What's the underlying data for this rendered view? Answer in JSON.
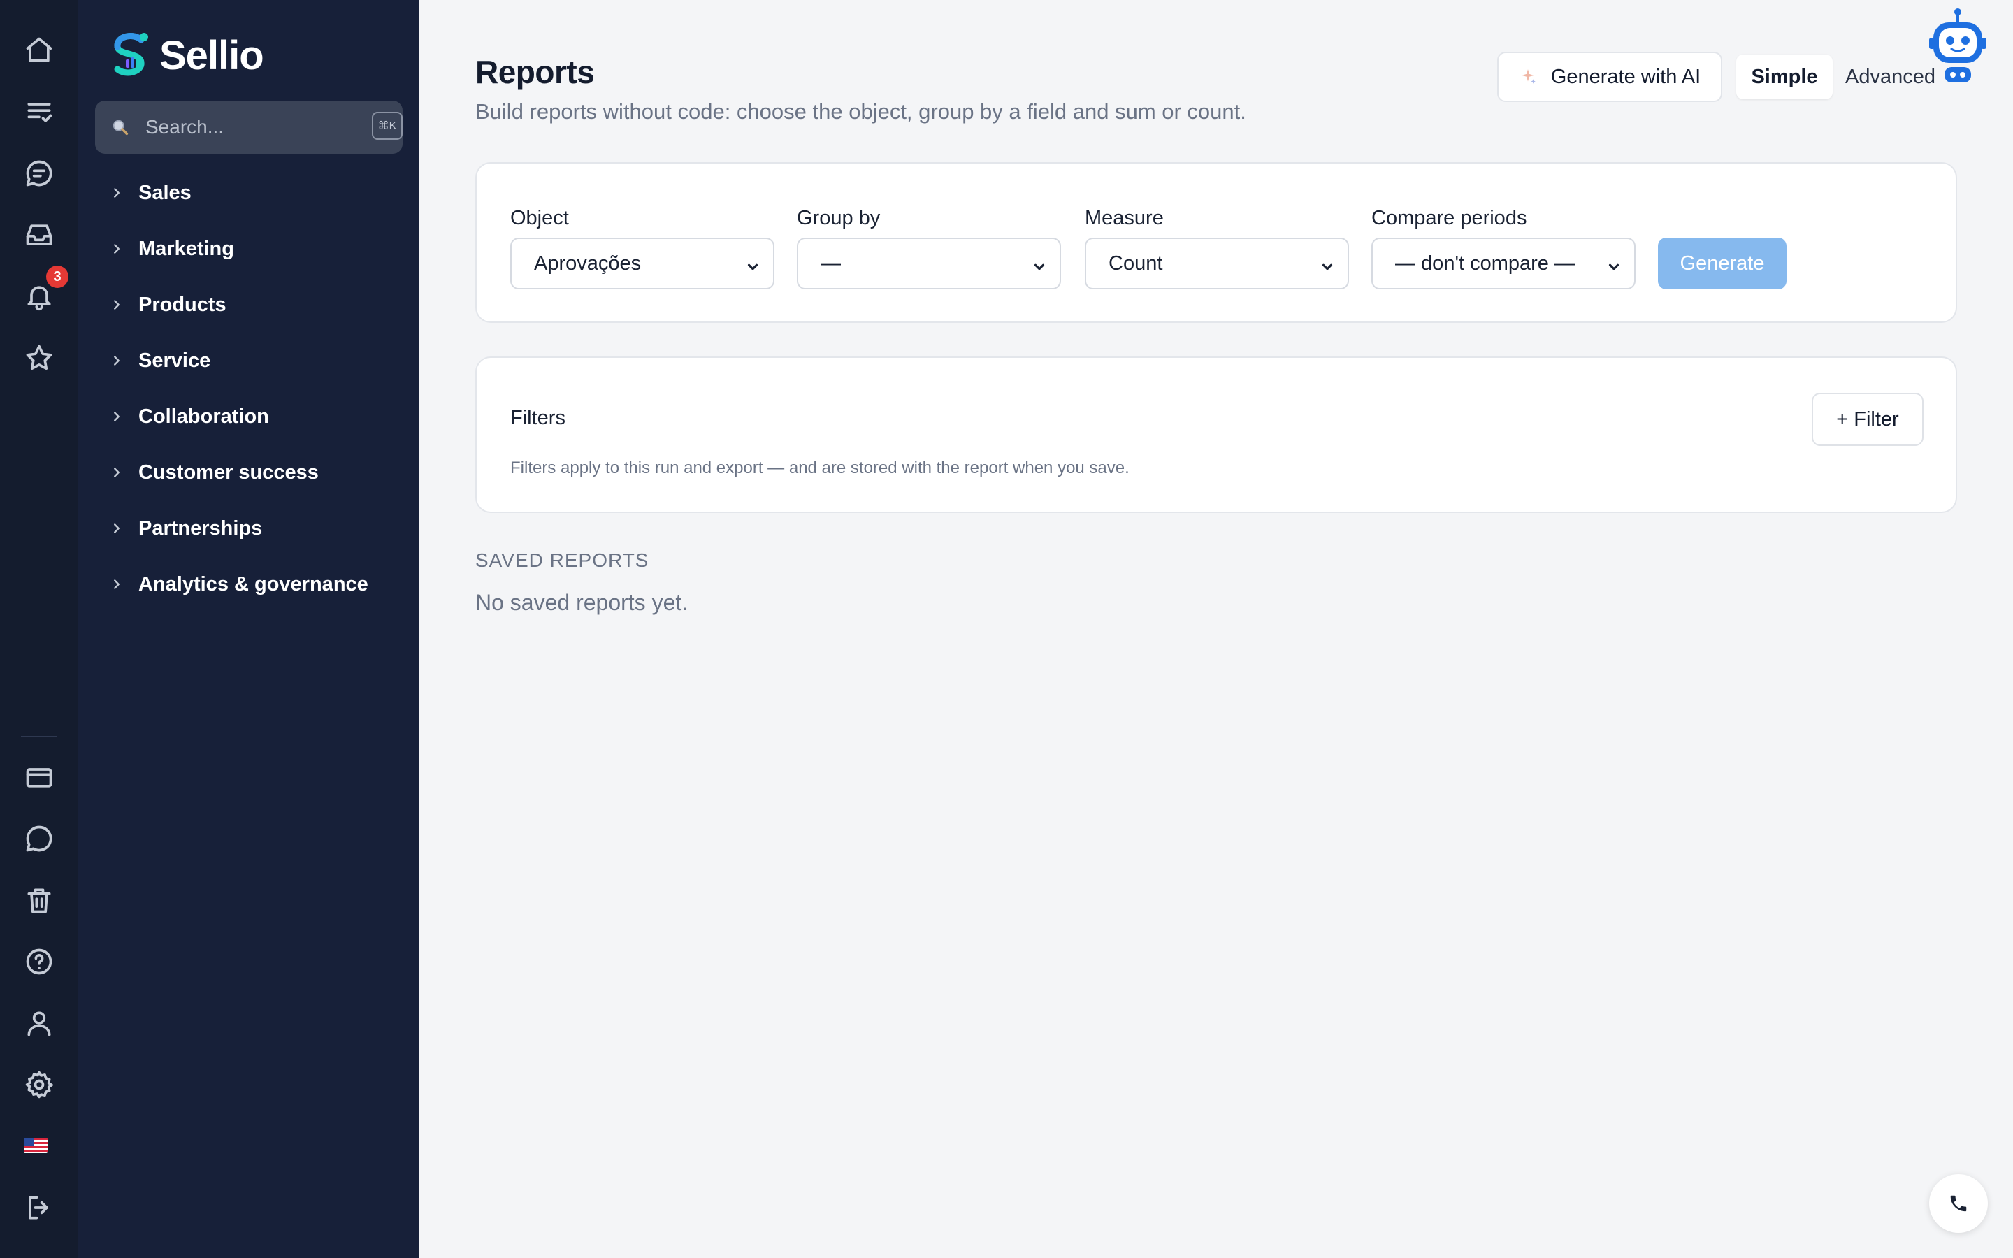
{
  "app": {
    "name": "Sellio"
  },
  "rail": {
    "notification_count": "3",
    "top_icons": [
      "home-icon",
      "tasks-icon",
      "chat-bubble-icon",
      "inbox-icon",
      "bell-icon",
      "star-icon"
    ],
    "bottom_icons": [
      "card-icon",
      "message-icon",
      "trash-icon",
      "help-icon",
      "user-icon",
      "gear-icon",
      "us-flag-icon",
      "logout-icon"
    ]
  },
  "search": {
    "placeholder": "Search...",
    "shortcut": "⌘K"
  },
  "nav": {
    "items": [
      {
        "label": "Sales"
      },
      {
        "label": "Marketing"
      },
      {
        "label": "Products"
      },
      {
        "label": "Service"
      },
      {
        "label": "Collaboration"
      },
      {
        "label": "Customer success"
      },
      {
        "label": "Partnerships"
      },
      {
        "label": "Analytics & governance"
      }
    ]
  },
  "header": {
    "title": "Reports",
    "subtitle": "Build reports without code: choose the object, group by a field and sum or count.",
    "ai_button": "Generate with AI",
    "mode_simple": "Simple",
    "mode_advanced": "Advanced",
    "active_mode": "Simple"
  },
  "config": {
    "object": {
      "label": "Object",
      "value": "Aprovações"
    },
    "group_by": {
      "label": "Group by",
      "value": "—"
    },
    "measure": {
      "label": "Measure",
      "value": "Count"
    },
    "compare": {
      "label": "Compare periods",
      "value": "— don't compare —"
    },
    "generate_button": "Generate"
  },
  "filters": {
    "title": "Filters",
    "add_button": "+ Filter",
    "note": "Filters apply to this run and export — and are stored with the report when you save."
  },
  "saved": {
    "heading": "SAVED REPORTS",
    "empty_text": "No saved reports yet."
  },
  "colors": {
    "rail_bg": "#141c2e",
    "nav_bg": "#172039",
    "page_bg": "#f4f5f7",
    "primary_disabled": "#86b9ee",
    "badge": "#e53935",
    "brand_teal": "#1fd1c1",
    "brand_blue": "#3b82f6"
  }
}
